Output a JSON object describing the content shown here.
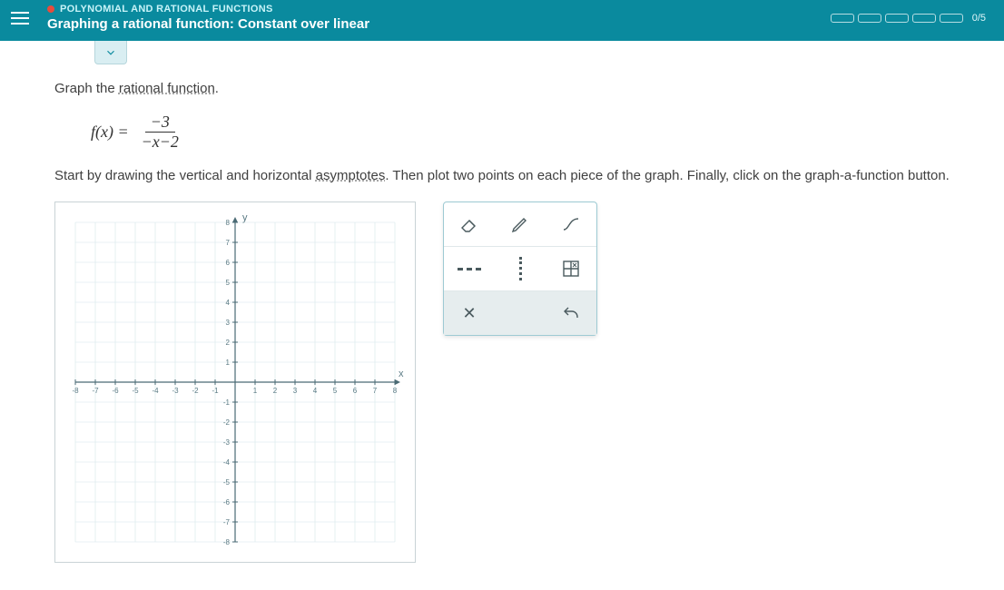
{
  "header": {
    "category": "POLYNOMIAL AND RATIONAL FUNCTIONS",
    "title": "Graphing a rational function: Constant over linear",
    "progress_label": "0/5"
  },
  "problem": {
    "line1_pre": "Graph the ",
    "line1_link": "rational function",
    "line1_post": ".",
    "formula_lhs": "f(x) =",
    "formula_num": "−3",
    "formula_den": "−x−2",
    "line2_pre": "Start by drawing the vertical and horizontal ",
    "line2_link": "asymptotes",
    "line2_post": ". Then plot two points on each piece of the graph. Finally, click on the graph-a-function button."
  },
  "graph": {
    "xlabel": "x",
    "ylabel": "y",
    "min": -8,
    "max": 8
  },
  "chart_data": {
    "type": "scatter",
    "title": "",
    "xlabel": "x",
    "ylabel": "y",
    "xlim": [
      -8,
      8
    ],
    "ylim": [
      -8,
      8
    ],
    "series": []
  }
}
